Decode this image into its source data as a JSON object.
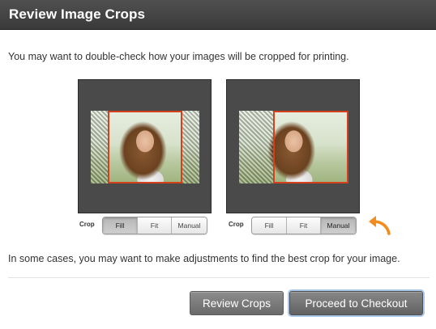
{
  "header": {
    "title": "Review Image Crops"
  },
  "intro_text": "You may want to double-check how your images will be cropped for printing.",
  "crop_examples": [
    {
      "label": "Crop",
      "options": [
        "Fill",
        "Fit",
        "Manual"
      ],
      "selected": "Fill"
    },
    {
      "label": "Crop",
      "options": [
        "Fill",
        "Fit",
        "Manual"
      ],
      "selected": "Manual"
    }
  ],
  "note_text": "In some cases, you may want to make adjustments to find the best crop for your image.",
  "actions": {
    "review_label": "Review Crops",
    "checkout_label": "Proceed to Checkout"
  },
  "colors": {
    "titlebar": "#444444",
    "crop_frame": "#d4401c",
    "arrow": "#f28c1e",
    "panel": "#4a4a4a"
  },
  "icons": {
    "arrow": "curved-arrow-icon"
  }
}
